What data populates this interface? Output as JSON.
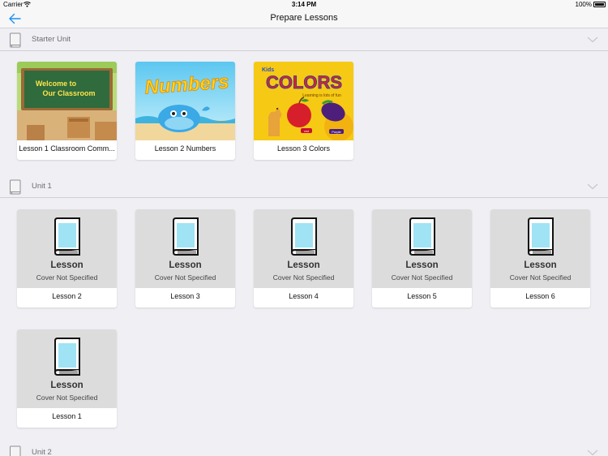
{
  "status_bar": {
    "carrier": "Carrier",
    "time": "3:14 PM",
    "battery": "100%"
  },
  "nav": {
    "title": "Prepare Lessons"
  },
  "sections": [
    {
      "label": "Starter Unit"
    },
    {
      "label": "Unit 1"
    },
    {
      "label": "Unit 2"
    }
  ],
  "starter_lessons": [
    {
      "title": "Lesson 1 Classroom Comm...",
      "cover_text": "Welcome to Our Classroom"
    },
    {
      "title": "Lesson 2 Numbers",
      "cover_text": "Numbers"
    },
    {
      "title": "Lesson 3 Colors",
      "cover_text": "COLORS",
      "cover_kids": "Kids",
      "cover_tagline": "Learning is lots of fun",
      "cover_red": "red",
      "cover_purple": "Purple"
    }
  ],
  "placeholder": {
    "title": "Lesson",
    "subtitle": "Cover Not Specified"
  },
  "unit1_lessons": [
    {
      "title": "Lesson 2"
    },
    {
      "title": "Lesson 3"
    },
    {
      "title": "Lesson 4"
    },
    {
      "title": "Lesson 5"
    },
    {
      "title": "Lesson 6"
    },
    {
      "title": "Lesson 1"
    }
  ],
  "colors": {
    "accent": "#1a8ff5",
    "background": "#efeff4",
    "placeholder_cover": "#dcdcdc"
  }
}
